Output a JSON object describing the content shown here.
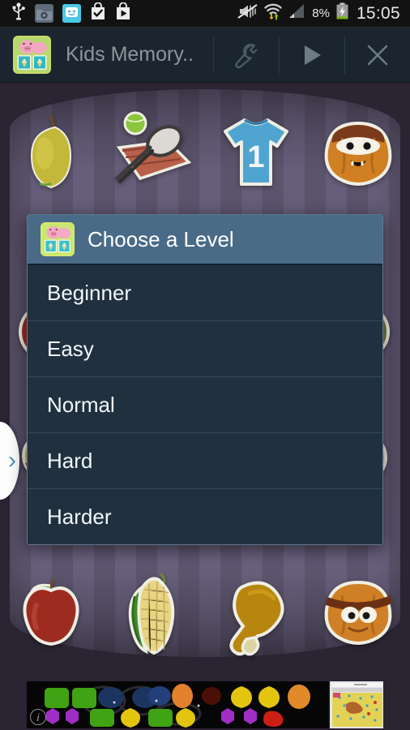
{
  "status_bar": {
    "time": "15:05",
    "battery_percent": "8%",
    "icons": [
      {
        "name": "usb-icon",
        "label": "USB"
      },
      {
        "name": "folder-settings-icon",
        "label": "Folder"
      },
      {
        "name": "messenger-icon",
        "label": "Chat"
      },
      {
        "name": "checkmark-bag-icon",
        "label": "Installed"
      },
      {
        "name": "play-store-bag-icon",
        "label": "Play Store"
      }
    ],
    "right_icons": [
      {
        "name": "mute-vibrate-off-icon",
        "label": "Silent"
      },
      {
        "name": "wifi-data-transfer-icon",
        "label": "Wi-Fi"
      },
      {
        "name": "signal-bars-icon",
        "label": "Signal"
      },
      {
        "name": "battery-charging-icon",
        "label": "Charging"
      }
    ]
  },
  "action_bar": {
    "app_icon_name": "kids-memory-app-icon",
    "title": "Kids Memory..",
    "buttons": [
      {
        "name": "settings-wrench-button",
        "label": "Settings"
      },
      {
        "name": "play-button",
        "label": "Play"
      },
      {
        "name": "close-button",
        "label": "Close"
      }
    ]
  },
  "dialog": {
    "icon_name": "kids-memory-dialog-icon",
    "title": "Choose a Level",
    "levels": [
      {
        "label": "Beginner"
      },
      {
        "label": "Easy"
      },
      {
        "label": "Normal"
      },
      {
        "label": "Hard"
      },
      {
        "label": "Harder"
      }
    ]
  },
  "game_board": {
    "rows": [
      {
        "cards": [
          {
            "name": "card-pear",
            "label": "Pear"
          },
          {
            "name": "card-tennis-racket",
            "label": "Tennis racket"
          },
          {
            "name": "card-blue-shirt",
            "label": "Blue shirt number 1",
            "number": "1"
          },
          {
            "name": "card-pumpkin-face",
            "label": "Pumpkin face"
          }
        ]
      },
      {
        "cards": [
          {
            "name": "card-hidden-1",
            "label": "Hidden"
          },
          {
            "name": "card-hidden-2",
            "label": "Hidden"
          },
          {
            "name": "card-hidden-3",
            "label": "Hidden"
          },
          {
            "name": "card-hidden-4",
            "label": "Hidden"
          }
        ]
      },
      {
        "cards": [
          {
            "name": "card-hidden-5",
            "label": "Hidden"
          },
          {
            "name": "card-hidden-6",
            "label": "Hidden"
          },
          {
            "name": "card-hidden-7",
            "label": "Hidden"
          },
          {
            "name": "card-hidden-8",
            "label": "Hidden"
          }
        ]
      },
      {
        "cards": [
          {
            "name": "card-apple",
            "label": "Apple"
          },
          {
            "name": "card-corn",
            "label": "Corn"
          },
          {
            "name": "card-chicken-leg",
            "label": "Chicken leg"
          },
          {
            "name": "card-pumpkin-bandit",
            "label": "Pumpkin with headband"
          }
        ]
      }
    ]
  },
  "pull_tab": {
    "name": "expand-panel-tab",
    "glyph": "›"
  },
  "ad": {
    "info_glyph": "i",
    "label": "Advertisement banner"
  },
  "colors": {
    "status_bar_bg": "#121212",
    "action_bar_bg": "#1b252f",
    "dialog_header_bg": "#4a6b87",
    "dialog_item_bg": "#20303f",
    "wallpaper_stripe_a": "#605872",
    "wallpaper_stripe_b": "#6b6380",
    "accent_text": "#ffffff"
  }
}
